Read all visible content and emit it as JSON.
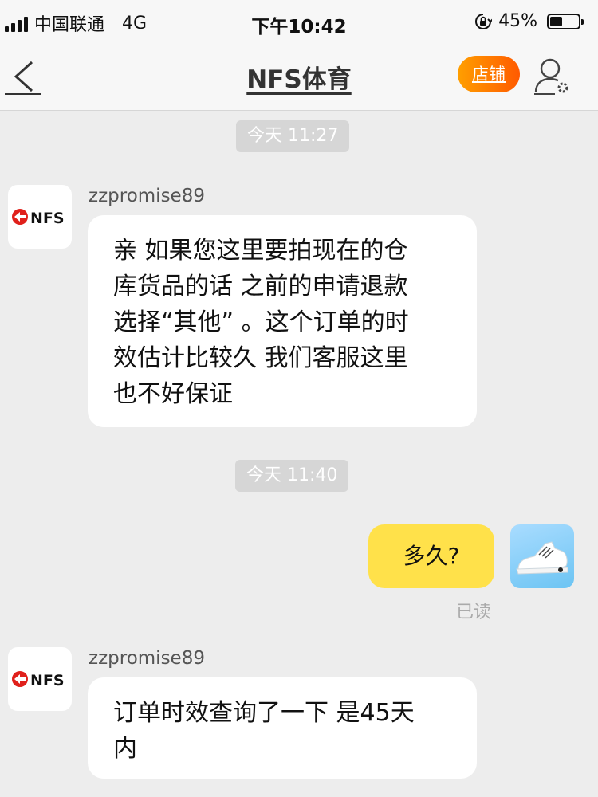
{
  "status_bar": {
    "carrier": "中国联通",
    "network": "4G",
    "time": "下午10:42",
    "battery_percent": "45%",
    "battery_level": 0.45
  },
  "nav": {
    "title": "NFS体育",
    "shop_label": "店铺",
    "back_icon": "chevron-left-icon",
    "profile_icon": "user-settings-icon"
  },
  "messages": {
    "stamp1": "今天 11:27",
    "stamp2": "今天 11:40",
    "m1": {
      "sender": "zzpromise89",
      "line1": "亲 如果您这里要拍现在的仓",
      "line2": "库货品的话 之前的申请退款",
      "line3": "选择“其他” 。这个订单的时",
      "line4": "效估计比较久 我们客服这里",
      "line5": "也不好保证"
    },
    "m2": {
      "text": "多久?",
      "status": "已读"
    },
    "m3": {
      "sender": "zzpromise89",
      "line1": "订单时效查询了一下 是45天",
      "line2": "内"
    }
  },
  "avatar_logo_text": "NFS",
  "colors": {
    "background": "#ededed",
    "shop_button": "#ff7a00",
    "my_bubble": "#ffe14a"
  }
}
